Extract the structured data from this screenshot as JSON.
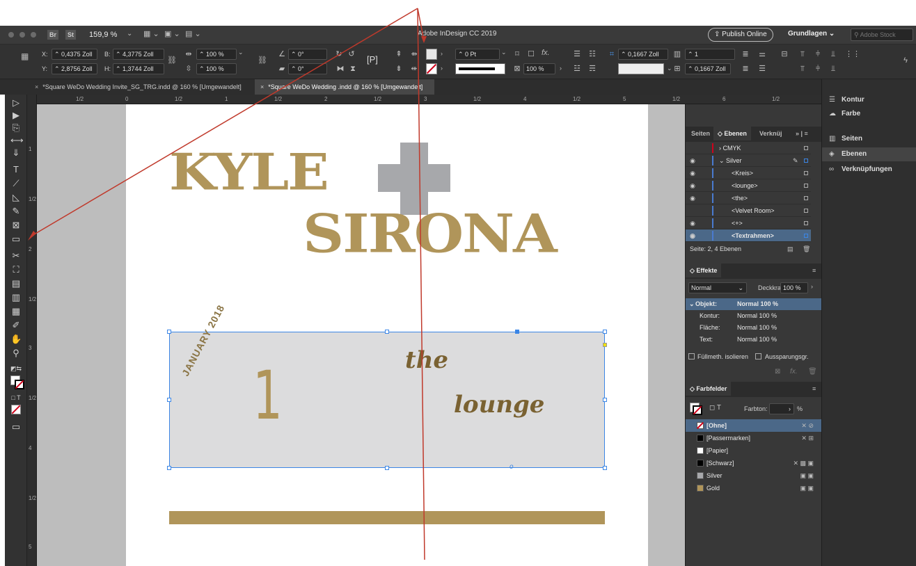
{
  "window": {
    "app_title": "Adobe InDesign CC 2019",
    "zoom": "159,9 %",
    "bridge_label": "Br",
    "stock_label": "St",
    "publish_label": "Publish Online",
    "workspace_label": "Grundlagen",
    "search_placeholder": "Adobe Stock"
  },
  "control": {
    "x_label": "X:",
    "x_value": "0,4375 Zoll",
    "y_label": "Y:",
    "y_value": "2,8756 Zoll",
    "w_label": "B:",
    "w_value": "4,3775 Zoll",
    "h_label": "H:",
    "h_value": "1,3744 Zoll",
    "scale_x": "100 %",
    "scale_y": "100 %",
    "angle": "0°",
    "shear": "0°",
    "stroke_weight": "0 Pt",
    "opacity": "100 %",
    "offset_1": "0,1667 Zoll",
    "offset_2": "0,1667 Zoll",
    "columns": "1"
  },
  "tabs": [
    {
      "label": "*Square WeDo Wedding Invite_SG_TRG.indd @ 160 % [Umgewandelt]"
    },
    {
      "label": "*Square WeDo Wedding .indd @ 160 % [Umgewandelt]"
    }
  ],
  "ruler": {
    "h_marks": [
      "1/2",
      "0",
      "1/2",
      "1",
      "1/2",
      "2",
      "1/2",
      "3",
      "1/2",
      "4",
      "1/2",
      "5",
      "1/2",
      "6",
      "1/2"
    ],
    "v_marks": [
      "1",
      "1/2",
      "2",
      "1/2",
      "3",
      "1/2",
      "4",
      "1/2",
      "5"
    ]
  },
  "document": {
    "line1": "KYLE",
    "line2": "SIRONA",
    "date_arc": "JANUARY 2018",
    "day": "1",
    "the": "the",
    "lounge": "lounge",
    "colors": {
      "gold": "#b0955a",
      "silver": "#a7a8ab",
      "frame_fill": "#dcdcdd",
      "dark_gold": "#7a6232",
      "selection": "#3b86e6"
    }
  },
  "layers_panel": {
    "tabs": [
      "Seiten",
      "Ebenen",
      "Verknüj"
    ],
    "rows": [
      {
        "name": "CMYK"
      },
      {
        "name": "Silver"
      },
      {
        "name": "<Kreis>"
      },
      {
        "name": "<lounge>"
      },
      {
        "name": "<the>"
      },
      {
        "name": "<Velvet Room>"
      },
      {
        "name": "<+>"
      },
      {
        "name": "<Textrahmen>"
      }
    ],
    "footer": "Seite: 2, 4 Ebenen"
  },
  "effects_panel": {
    "title": "Effekte",
    "mode": "Normal",
    "opacity_label": "Deckkraft:",
    "opacity_value": "100 %",
    "rows": [
      {
        "k": "Objekt:",
        "v": "Normal 100 %"
      },
      {
        "k": "Kontur:",
        "v": "Normal 100 %"
      },
      {
        "k": "Fläche:",
        "v": "Normal 100 %"
      },
      {
        "k": "Text:",
        "v": "Normal 100 %"
      }
    ],
    "isolate_label": "Füllmeth. isolieren",
    "knockout_label": "Aussparungsgr."
  },
  "swatches_panel": {
    "title": "Farbfelder",
    "tint_label": "Farbton:",
    "tint_unit": "%",
    "swatches": [
      {
        "name": "[Ohne]",
        "color": "#ffffff"
      },
      {
        "name": "[Passermarken]",
        "color": "#000000"
      },
      {
        "name": "[Papier]",
        "color": "#ffffff"
      },
      {
        "name": "[Schwarz]",
        "color": "#000000"
      },
      {
        "name": "Silver",
        "color": "#a7a8ab"
      },
      {
        "name": "Gold",
        "color": "#b0955a"
      }
    ]
  },
  "dock": {
    "items": [
      {
        "label": "Kontur",
        "icon": "stroke-icon"
      },
      {
        "label": "Farbe",
        "icon": "color-icon"
      },
      {
        "label": "Seiten",
        "icon": "pages-icon"
      },
      {
        "label": "Ebenen",
        "icon": "layers-icon"
      },
      {
        "label": "Verknüpfungen",
        "icon": "links-icon"
      }
    ]
  }
}
